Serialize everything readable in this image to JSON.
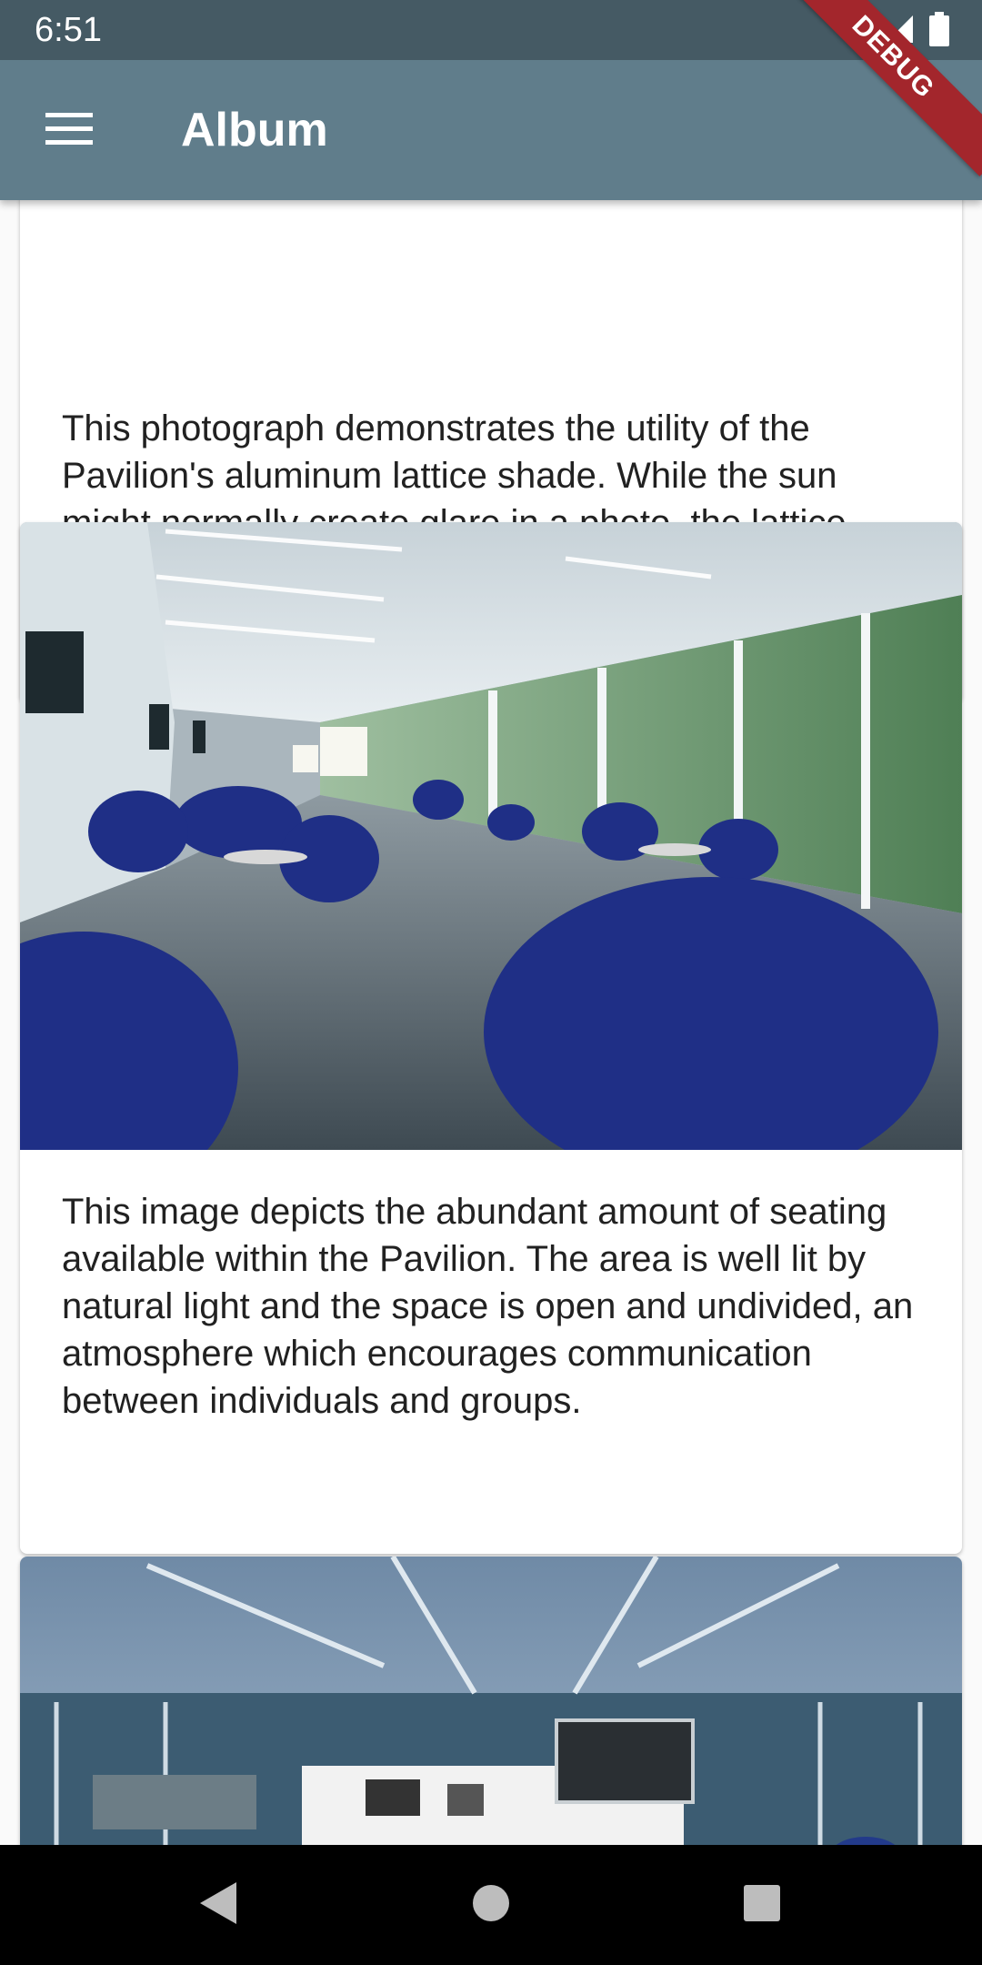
{
  "status_bar": {
    "time": "6:51",
    "icons": [
      "wifi-icon",
      "signal-icon",
      "battery-icon"
    ]
  },
  "app_bar": {
    "title": "Album",
    "menu_icon": "menu-icon",
    "background": "#607d8b"
  },
  "debug_banner": "DEBUG",
  "cards": [
    {
      "text": "This photograph demonstrates the utility of the Pavilion's aluminum lattice shade. While the sun might normally create glare in a photo, the lattice shade filters out much of the light, allowing for a clear picture."
    },
    {
      "image": "pavilion-seating-photo",
      "text": "This image depicts the abundant amount of seating available within the Pavilion. The area is well lit by natural light and the space is open and undivided, an atmosphere which encourages communication between individuals and groups."
    },
    {
      "image": "pavilion-cafe-counter-photo"
    }
  ],
  "nav_bar": {
    "icons": [
      "back-icon",
      "home-icon",
      "recents-icon"
    ]
  }
}
